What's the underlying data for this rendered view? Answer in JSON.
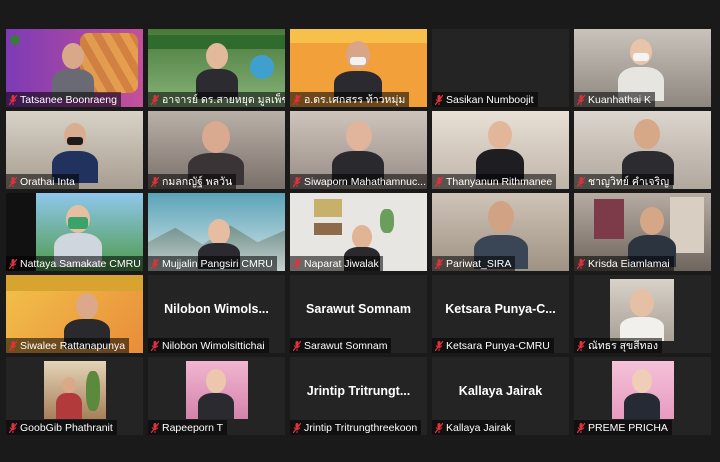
{
  "participants": [
    {
      "name": "Tatsanee Boonraeng",
      "mic_muted": true
    },
    {
      "name": "อาจารย์ ดร.สายหยุด มูลเพ็ชร์",
      "mic_muted": true
    },
    {
      "name": "อ.ดร.เศกสรร ท้าวหมุ่ม",
      "mic_muted": true
    },
    {
      "name": "Sasikan Numboojit",
      "mic_muted": true
    },
    {
      "name": "Kuanhathai K",
      "mic_muted": true
    },
    {
      "name": "Orathai Inta",
      "mic_muted": true
    },
    {
      "name": "กมลกญัฐ์ พลวัน",
      "mic_muted": true
    },
    {
      "name": "Siwaporn Mahathamnuc...",
      "mic_muted": true
    },
    {
      "name": "Thanyanun Rithmanee",
      "mic_muted": true
    },
    {
      "name": "ชาญวิทย์ คำเจริญ",
      "mic_muted": true
    },
    {
      "name": "Nattaya Samakate CMRU",
      "mic_muted": true
    },
    {
      "name": "Mujjalin Pangsiri CMRU",
      "mic_muted": true
    },
    {
      "name": "Naparat Jiwalak",
      "mic_muted": true
    },
    {
      "name": "Pariwat_SIRA",
      "mic_muted": true
    },
    {
      "name": "Krisda Eiamlamai",
      "mic_muted": true
    },
    {
      "name": "Siwalee Rattanapunya",
      "mic_muted": true
    },
    {
      "name": "Nilobon Wimolsittichai",
      "display_name": "Nilobon  Wimols...",
      "mic_muted": true
    },
    {
      "name": "Sarawut Somnam",
      "display_name": "Sarawut  Somnam",
      "mic_muted": true
    },
    {
      "name": "Ketsara Punya-CMRU",
      "display_name": "Ketsara  Punya-C...",
      "mic_muted": true
    },
    {
      "name": "ณัทธร สุขสีทอง",
      "mic_muted": true
    },
    {
      "name": "GoobGib Phathranit",
      "mic_muted": true
    },
    {
      "name": "Rapeeporn T",
      "mic_muted": true
    },
    {
      "name": "Jrintip Tritrungthreekoon",
      "display_name": "Jrintip  Tritrungt...",
      "mic_muted": true
    },
    {
      "name": "Kallaya Jairak",
      "display_name": "Kallaya  Jairak",
      "mic_muted": true
    },
    {
      "name": "PREME PRICHA",
      "mic_muted": true
    }
  ],
  "colors": {
    "background": "#1a1a1a",
    "tile_off": "#242424",
    "muted_mic": "#e0323c"
  }
}
